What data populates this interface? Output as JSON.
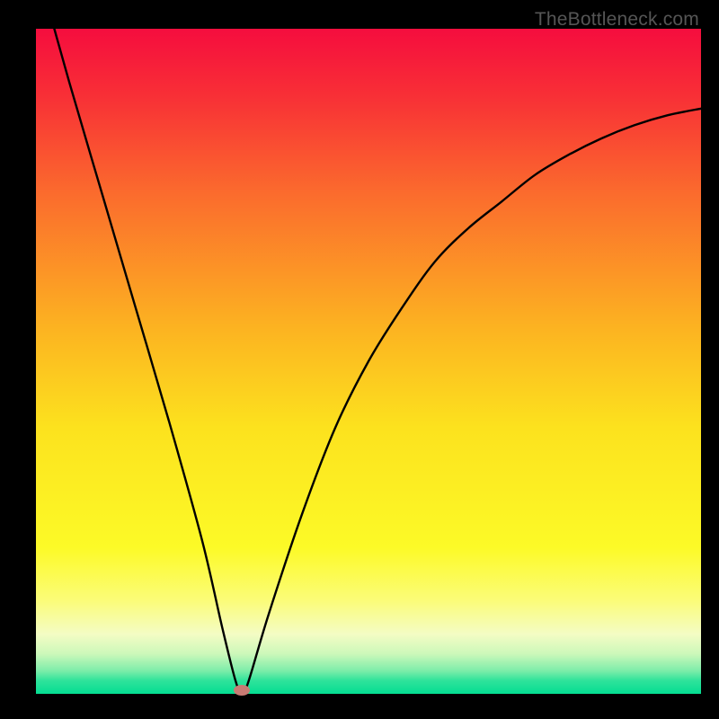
{
  "watermark": "TheBottleneck.com",
  "chart_data": {
    "type": "line",
    "title": "",
    "xlabel": "",
    "ylabel": "",
    "xlim": [
      0,
      100
    ],
    "ylim": [
      0,
      100
    ],
    "grid": false,
    "legend": false,
    "series": [
      {
        "name": "bottleneck-curve",
        "x": [
          0,
          5,
          10,
          15,
          20,
          25,
          28,
          30,
          31,
          32,
          35,
          40,
          45,
          50,
          55,
          60,
          65,
          70,
          75,
          80,
          85,
          90,
          95,
          100
        ],
        "values": [
          110,
          92,
          75,
          58,
          41,
          23,
          10,
          2,
          0,
          2,
          12,
          27,
          40,
          50,
          58,
          65,
          70,
          74,
          78,
          81,
          83.5,
          85.5,
          87,
          88
        ]
      }
    ],
    "annotations": [
      {
        "name": "optimum-marker",
        "x": 31,
        "y": 0.5,
        "color": "#c97b74"
      }
    ],
    "background_gradient": {
      "stops": [
        {
          "pct": 0,
          "color": "#f50d3e"
        },
        {
          "pct": 10,
          "color": "#f82f36"
        },
        {
          "pct": 25,
          "color": "#fb6c2d"
        },
        {
          "pct": 45,
          "color": "#fcb321"
        },
        {
          "pct": 60,
          "color": "#fce21e"
        },
        {
          "pct": 78,
          "color": "#fcfa27"
        },
        {
          "pct": 86,
          "color": "#fbfc79"
        },
        {
          "pct": 91,
          "color": "#f4fcc4"
        },
        {
          "pct": 94,
          "color": "#ccf8ba"
        },
        {
          "pct": 96.5,
          "color": "#7eedaa"
        },
        {
          "pct": 98,
          "color": "#2fe39b"
        },
        {
          "pct": 100,
          "color": "#04dd92"
        }
      ]
    }
  }
}
